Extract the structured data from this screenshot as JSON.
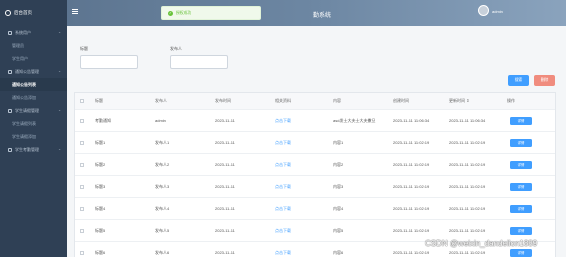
{
  "brand": "后台首页",
  "sidebar": {
    "items": [
      {
        "type": "group",
        "label": "系统用户",
        "icon": "user-icon"
      },
      {
        "type": "sub",
        "label": "管理员"
      },
      {
        "type": "sub",
        "label": "学生用户"
      },
      {
        "type": "group",
        "label": "通知公告管理",
        "icon": "notice-icon"
      },
      {
        "type": "sub",
        "label": "通知公告列表",
        "active": true
      },
      {
        "type": "sub",
        "label": "通知公告添加"
      },
      {
        "type": "group",
        "label": "学生请假管理",
        "icon": "leave-icon"
      },
      {
        "type": "sub",
        "label": "学生请假列表"
      },
      {
        "type": "sub",
        "label": "学生请假添加"
      },
      {
        "type": "group",
        "label": "学生考勤管理",
        "icon": "attendance-icon"
      }
    ]
  },
  "header": {
    "title": "勤系统",
    "username": "admin"
  },
  "toast": {
    "message": "授权成功"
  },
  "search": {
    "title_label": "标题",
    "title_value": "",
    "publisher_label": "发布人",
    "publisher_value": ""
  },
  "actions": {
    "search_label": "搜索",
    "delete_label": "删除",
    "search_color": "#409eff",
    "delete_color": "#f08c7e"
  },
  "table": {
    "columns": [
      "标题",
      "发布人",
      "发布时间",
      "相关资料",
      "内容",
      "创建时间",
      "更新时间 ⇕",
      "操作"
    ],
    "rows": [
      {
        "title": "考勤通知",
        "publisher": "admin",
        "date": "2023-11-11",
        "file": "点击下载",
        "content": "asd发士大夫士大夫撒旦",
        "created": "2023-11-11 11:06:34",
        "updated": "2023-11-11 11:06:34",
        "action": "详情"
      },
      {
        "title": "标题1",
        "publisher": "发布人1",
        "date": "2023-11-11",
        "file": "点击下载",
        "content": "内容1",
        "created": "2023-11-11 11:02:19",
        "updated": "2023-11-11 11:02:19",
        "action": "详情"
      },
      {
        "title": "标题2",
        "publisher": "发布人2",
        "date": "2023-11-11",
        "file": "点击下载",
        "content": "内容2",
        "created": "2023-11-11 11:02:19",
        "updated": "2023-11-11 11:02:19",
        "action": "详情"
      },
      {
        "title": "标题3",
        "publisher": "发布人3",
        "date": "2023-11-11",
        "file": "点击下载",
        "content": "内容3",
        "created": "2023-11-11 11:02:19",
        "updated": "2023-11-11 11:02:19",
        "action": "详情"
      },
      {
        "title": "标题4",
        "publisher": "发布人4",
        "date": "2023-11-11",
        "file": "点击下载",
        "content": "内容4",
        "created": "2023-11-11 11:02:19",
        "updated": "2023-11-11 11:02:19",
        "action": "详情"
      },
      {
        "title": "标题5",
        "publisher": "发布人5",
        "date": "2023-11-11",
        "file": "点击下载",
        "content": "内容5",
        "created": "2023-11-11 11:02:19",
        "updated": "2023-11-11 11:02:19",
        "action": "详情"
      },
      {
        "title": "标题6",
        "publisher": "发布人6",
        "date": "2023-11-11",
        "file": "点击下载",
        "content": "内容6",
        "created": "2023-11-11 11:02:19",
        "updated": "2023-11-11 11:02:19",
        "action": "详情"
      }
    ]
  },
  "watermark": "CSDN @weixin_dandelion1889"
}
